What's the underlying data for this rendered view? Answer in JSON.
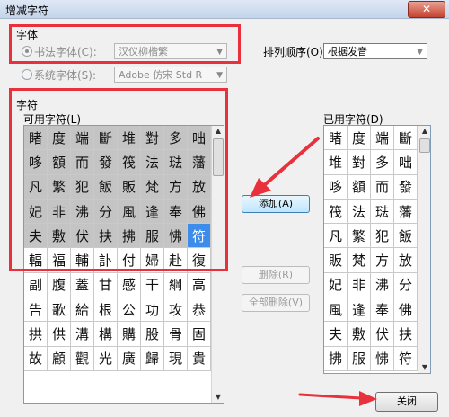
{
  "window": {
    "title": "增减字符",
    "close_glyph": "✕"
  },
  "font_group": {
    "title": "字体",
    "calligraphy_label": "书法字体(C):",
    "calligraphy_value": "汉仪柳楷繁",
    "system_label": "系统字体(S):",
    "system_value": "Adobe 仿宋 Std R"
  },
  "sort": {
    "label": "排列顺序(O):",
    "value": "根据发音"
  },
  "chars_group": {
    "title": "字符"
  },
  "available": {
    "label": "可用字符(L)",
    "cells": [
      "睹",
      "度",
      "端",
      "斷",
      "堆",
      "對",
      "多",
      "咄",
      "哆",
      "額",
      "而",
      "發",
      "筏",
      "法",
      "琺",
      "藩",
      "凡",
      "繁",
      "犯",
      "飯",
      "販",
      "梵",
      "方",
      "放",
      "妃",
      "非",
      "沸",
      "分",
      "風",
      "逢",
      "奉",
      "佛",
      "夫",
      "敷",
      "伏",
      "扶",
      "拂",
      "服",
      "怫",
      "符",
      "輻",
      "福",
      "輔",
      "訃",
      "付",
      "婦",
      "赴",
      "復",
      "副",
      "腹",
      "蓋",
      "甘",
      "感",
      "干",
      "綱",
      "高",
      "告",
      "歌",
      "給",
      "根",
      "公",
      "功",
      "攻",
      "恭",
      "拱",
      "供",
      "溝",
      "構",
      "購",
      "股",
      "骨",
      "固",
      "故",
      "顧",
      "觀",
      "光",
      "廣",
      "歸",
      "現",
      "貴"
    ]
  },
  "used": {
    "label": "已用字符(D)",
    "cells": [
      "睹",
      "度",
      "端",
      "斷",
      "堆",
      "對",
      "多",
      "咄",
      "哆",
      "額",
      "而",
      "發",
      "筏",
      "法",
      "琺",
      "藩",
      "凡",
      "繁",
      "犯",
      "飯",
      "販",
      "梵",
      "方",
      "放",
      "妃",
      "非",
      "沸",
      "分",
      "風",
      "逢",
      "奉",
      "佛",
      "夫",
      "敷",
      "伏",
      "扶",
      "拂",
      "服",
      "怫",
      "符"
    ]
  },
  "buttons": {
    "add": "添加(A)",
    "delete": "删除(R)",
    "delete_all": "全部删除(V)",
    "close": "关闭"
  },
  "colors": {
    "annotation_red": "#e8313c",
    "selected_cell": "#c4c4c4",
    "highlight_cell": "#3d8ce9"
  },
  "icons": {
    "scroll_up": "▲",
    "scroll_down": "▼",
    "dropdown": "▼"
  }
}
